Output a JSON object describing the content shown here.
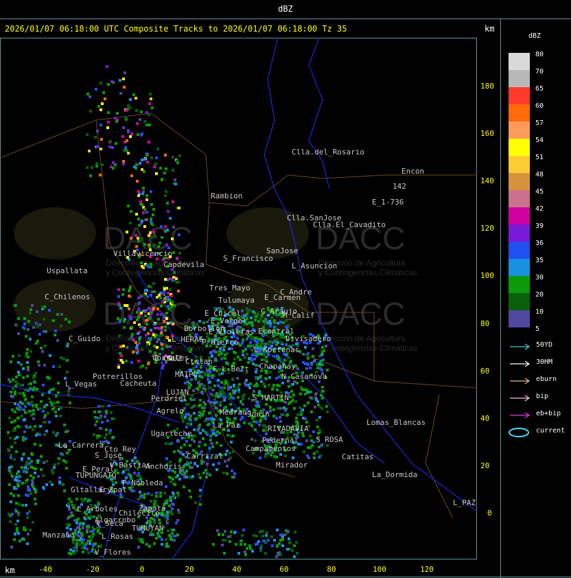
{
  "header": {
    "units_title": "dBZ",
    "run_title": "2026/01/07 06:18:00 UTC Composite Tracks to 2026/01/07 06:18:00 Tz 35",
    "km_label_top": "km",
    "km_label_bottom": "km"
  },
  "axes": {
    "y_ticks": [
      "180",
      "160",
      "140",
      "120",
      "100",
      "80",
      "60",
      "40",
      "20",
      "0"
    ],
    "x_ticks": [
      "-40",
      "-20",
      "0",
      "20",
      "40",
      "60",
      "80",
      "100",
      "120"
    ]
  },
  "watermark": {
    "brand": "DACC",
    "tagline_1": "Dirección de Agricultura",
    "tagline_2": "y Contingencias Climáticas"
  },
  "places": [
    "Clla.del_Rosario",
    "Encon",
    "142",
    "E_1-736",
    "Rambion",
    "Clla.SanJose",
    "Clla.El_Cavadito",
    "S_Francisco",
    "SanJose",
    "Villavicencio",
    "Capdevila",
    "L_Asuncion",
    "Uspallata",
    "Tres_Mayo",
    "C_Andre",
    "C_Chilenos",
    "Tulumaya",
    "E_Carmen",
    "C_Araujo",
    "E_Chical",
    "E_Vergel",
    "M_Calif",
    "Borbollon",
    "E_Violetas",
    "Ecentral",
    "Divisadero",
    "C_Guido",
    "L_HERAS",
    "P_Hierro",
    "L_Kortenas",
    "Chapanay",
    "L_Vegas",
    "Potrerillos",
    "Cacheuta",
    "G_CRUZ",
    "F_L_Belt",
    "MAIPU",
    "N_Casanova",
    "Perdriel",
    "Agrelo",
    "LUJAN",
    "S_MARTIN",
    "Lomas_Blancas",
    "Ugarteche",
    "RIVADAVIA",
    "S_ROSA",
    "La_Carrera",
    "Cto_Rey",
    "S_Jose",
    "Carrizal",
    "Catitas",
    "E_Peral",
    "TUPUNGATO",
    "Anchoris",
    "La_Dormida",
    "Gltallary",
    "E_Zpal",
    "L_Arboles",
    "Algarrobo",
    "Zapata",
    "Manzano",
    "V_Seca",
    "TUNUYAN",
    "Chilecito",
    "L_Rosas",
    "V_Flores",
    "L_PAZ",
    "Junin",
    "Medrano",
    "La_Paz",
    "Mirador",
    "Campamentos",
    "Pedernal",
    "P_Nobleda",
    "V_Bastias",
    "Ctalan",
    "Corrales"
  ],
  "legend": {
    "title": "dBZ",
    "scale": [
      {
        "label": "80",
        "color": "#d9d9d9"
      },
      {
        "label": "70",
        "color": "#b8b8b8"
      },
      {
        "label": "65",
        "color": "#ff3a2a"
      },
      {
        "label": "60",
        "color": "#ff6a0a"
      },
      {
        "label": "57",
        "color": "#ff9a5a"
      },
      {
        "label": "54",
        "color": "#ffff00"
      },
      {
        "label": "51",
        "color": "#ffcc33"
      },
      {
        "label": "48",
        "color": "#d6923c"
      },
      {
        "label": "45",
        "color": "#cc7090"
      },
      {
        "label": "42",
        "color": "#d000a0"
      },
      {
        "label": "39",
        "color": "#7a18d8"
      },
      {
        "label": "36",
        "color": "#2050f0"
      },
      {
        "label": "35",
        "color": "#1890e0"
      },
      {
        "label": "30",
        "color": "#0a9a0a"
      },
      {
        "label": "20",
        "color": "#086008"
      },
      {
        "label": "10",
        "color": "#5048a0"
      },
      {
        "label": "5",
        "color": "#5048a0"
      }
    ],
    "tracks": [
      {
        "label": "50YD",
        "color": "#40d0e0"
      },
      {
        "label": "30HM",
        "color": "#ffffff"
      },
      {
        "label": "eburn",
        "color": "#e8c080"
      },
      {
        "label": "bip",
        "color": "#ffc0e0"
      },
      {
        "label": "eb+bip",
        "color": "#e040e0"
      },
      {
        "label": "current",
        "color": "#40e0ff"
      }
    ]
  }
}
